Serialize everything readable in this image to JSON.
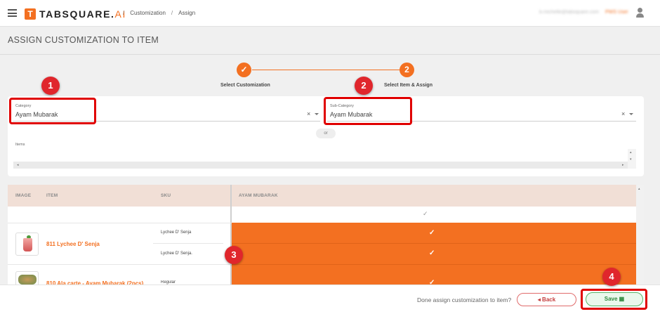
{
  "header": {
    "logo_mark": "T",
    "logo_text": "TABSQUARE.",
    "logo_suffix": "AI",
    "breadcrumb": [
      "Customization",
      "Assign"
    ],
    "breadcrumb_sep": "/",
    "user_email": "b.michelle@tabsquare.com",
    "user_tag": "PWS User"
  },
  "page": {
    "title": "ASSIGN CUSTOMIZATION TO ITEM"
  },
  "stepper": {
    "step1": {
      "icon": "✓",
      "label": "Select Customization",
      "state": "completed"
    },
    "step2": {
      "number": "2",
      "label": "Select Item & Assign",
      "state": "active"
    }
  },
  "filters": {
    "category": {
      "label": "Category",
      "value": "Ayam Mubarak"
    },
    "subcategory": {
      "label": "Sub-Category",
      "value": "Ayam Mubarak"
    },
    "or_text": "or",
    "items_label": "Items",
    "clear_glyph": "×"
  },
  "table": {
    "headers": {
      "image": "IMAGE",
      "item": "ITEM",
      "sku": "SKU",
      "assign": "AYAM MUBARAK"
    },
    "rows": [
      {
        "name": "811 Lychee D' Senja",
        "skus": [
          "Lychee D' Senja",
          "Lychee D' Senja."
        ]
      },
      {
        "name": "810 Ala carte - Ayam Mubarak (2pcs)",
        "skus": [
          "Regular"
        ]
      }
    ],
    "check": "✓"
  },
  "footer": {
    "prompt": "Done assign customization to item?",
    "back_label": "◂ Back",
    "save_label": "Save ▦"
  },
  "annotations": [
    "1",
    "2",
    "3",
    "4"
  ],
  "colors": {
    "accent": "#f37021",
    "highlight": "#e00000",
    "save_green": "#2f8a3f",
    "back_red": "#c43c3c"
  }
}
